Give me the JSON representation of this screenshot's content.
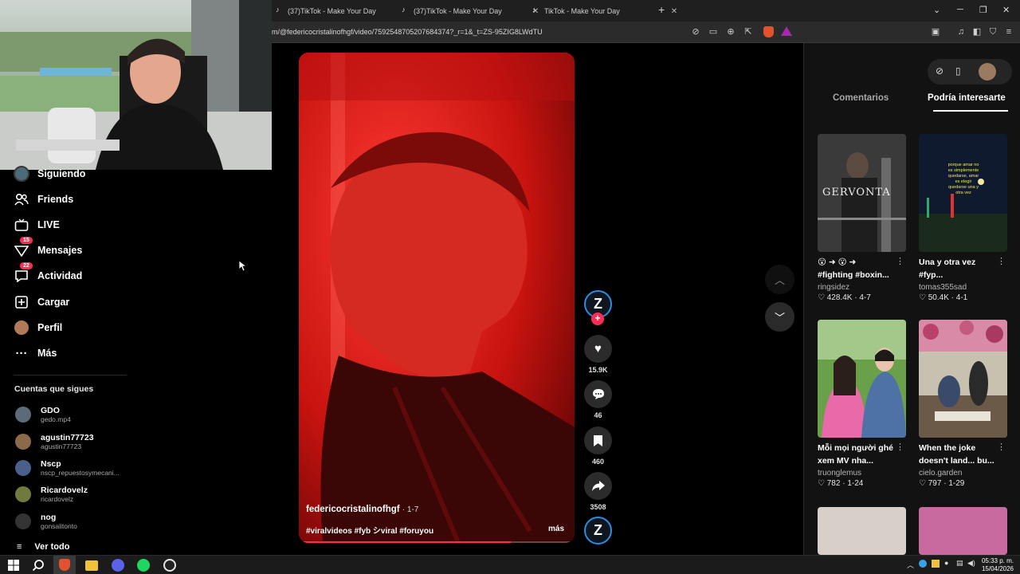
{
  "browser": {
    "tabs": [
      {
        "title": "(37)TikTok - Make Your Day"
      },
      {
        "title": "(37)TikTok - Make Your Day"
      },
      {
        "title": "TikTok - Make Your Day"
      }
    ],
    "url": "m/@federicocristalinofhgf/video/7592548705207684374?_r=1&_t=ZS-95ZIG8LWdTU",
    "new_tab_label": "+"
  },
  "sidebar": {
    "items": [
      {
        "label": "Siguiendo",
        "icon": "following-avatar-icon"
      },
      {
        "label": "Friends",
        "icon": "friends-icon"
      },
      {
        "label": "LIVE",
        "icon": "live-icon"
      },
      {
        "label": "Mensajes",
        "icon": "messages-icon",
        "badge": "15"
      },
      {
        "label": "Actividad",
        "icon": "activity-icon",
        "badge": "22"
      },
      {
        "label": "Cargar",
        "icon": "upload-icon"
      },
      {
        "label": "Perfil",
        "icon": "profile-icon"
      },
      {
        "label": "Más",
        "icon": "more-icon"
      }
    ],
    "following_title": "Cuentas que sigues",
    "accounts": [
      {
        "name": "GDO",
        "handle": "gedo.mp4",
        "color": "#5c6b7a"
      },
      {
        "name": "agustin77723",
        "handle": "agustin77723",
        "color": "#8a6a4a"
      },
      {
        "name": "Nscp",
        "handle": "nscp_repuestosymecani...",
        "color": "#4a5f8a"
      },
      {
        "name": "Ricardovelz",
        "handle": "ricardovelz",
        "color": "#6f7a3c"
      },
      {
        "name": "nog",
        "handle": "gonsalitonto",
        "color": "#333333"
      }
    ],
    "see_all": "Ver todo"
  },
  "video": {
    "username": "federicocristalinofhgf",
    "date": "· 1-7",
    "tags": "#viralvideos #fyb シviral #foruyou",
    "more_label": "más",
    "progress": 0.77
  },
  "actions": {
    "likes": "15.9K",
    "comments": "46",
    "saves": "460",
    "shares": "3508"
  },
  "right_panel": {
    "tabs": [
      "Comentarios",
      "Podría interesarte"
    ],
    "active_tab": 1,
    "cards": [
      {
        "title": "😮 ➜ 😮 ➜",
        "title2": "#fighting #boxin...",
        "author": "ringsidez",
        "likes": "428.4K",
        "date": "4-7",
        "thumb_text": "GERVONTA"
      },
      {
        "title": "Una y otra vez",
        "title2": "#fyp...",
        "author": "tomas355sad",
        "likes": "50.4K",
        "date": "4-1",
        "thumb_text": "porque amar no es simplemente quedarse, amar es elegir quedarse una y otra vez"
      },
      {
        "title": "Mỗi mọi người ghé",
        "title2": "xem MV nha...",
        "author": "truonglemus",
        "likes": "782",
        "date": "1-24",
        "thumb_text": ""
      },
      {
        "title": "When the joke",
        "title2": "doesn't land... bu...",
        "author": "cielo.garden",
        "likes": "797",
        "date": "1-29",
        "thumb_text": ""
      }
    ]
  },
  "taskbar": {
    "time": "05:33 p. m.",
    "date": "15/04/2026"
  },
  "colors": {
    "accent": "#fe2c55",
    "video_red": "#c40e0e"
  }
}
